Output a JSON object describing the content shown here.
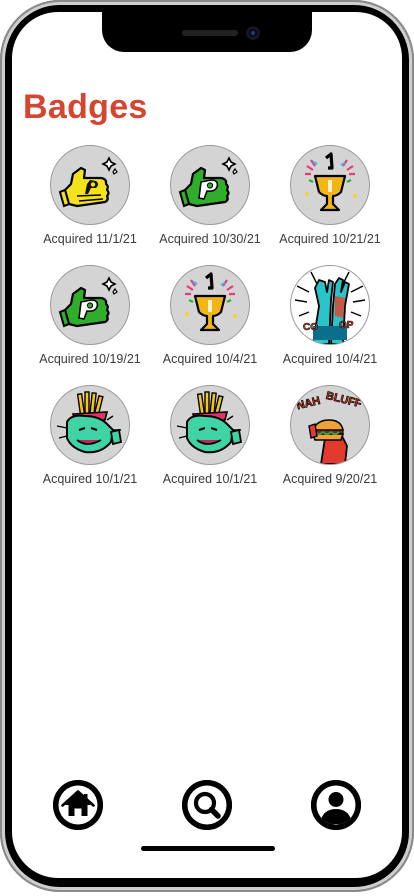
{
  "page": {
    "title": "Badges"
  },
  "badges": [
    {
      "icon": "thumbs-up-yellow-badge-icon",
      "caption": "Acquired 11/1/21"
    },
    {
      "icon": "thumbs-up-green-badge-icon",
      "caption": "Acquired 10/30/21"
    },
    {
      "icon": "trophy-badge-icon",
      "caption": "Acquired 10/21/21"
    },
    {
      "icon": "thumbs-up-green-badge-icon",
      "caption": "Acquired 10/19/21"
    },
    {
      "icon": "trophy-badge-icon",
      "caption": "Acquired 10/4/21"
    },
    {
      "icon": "high-five-coop-badge-icon",
      "caption": "Acquired 10/4/21"
    },
    {
      "icon": "fries-eater-badge-icon",
      "caption": "Acquired 10/1/21"
    },
    {
      "icon": "fries-eater-badge-icon",
      "caption": "Acquired 10/1/21"
    },
    {
      "icon": "burger-nah-bluff-badge-icon",
      "caption": "Acquired 9/20/21"
    }
  ],
  "tabbar": [
    {
      "icon": "home-icon"
    },
    {
      "icon": "search-icon"
    },
    {
      "icon": "profile-icon"
    }
  ],
  "colors": {
    "title": "#d6452f",
    "badge_bg": "#d4d4d4",
    "tab_icon": "#000000"
  }
}
